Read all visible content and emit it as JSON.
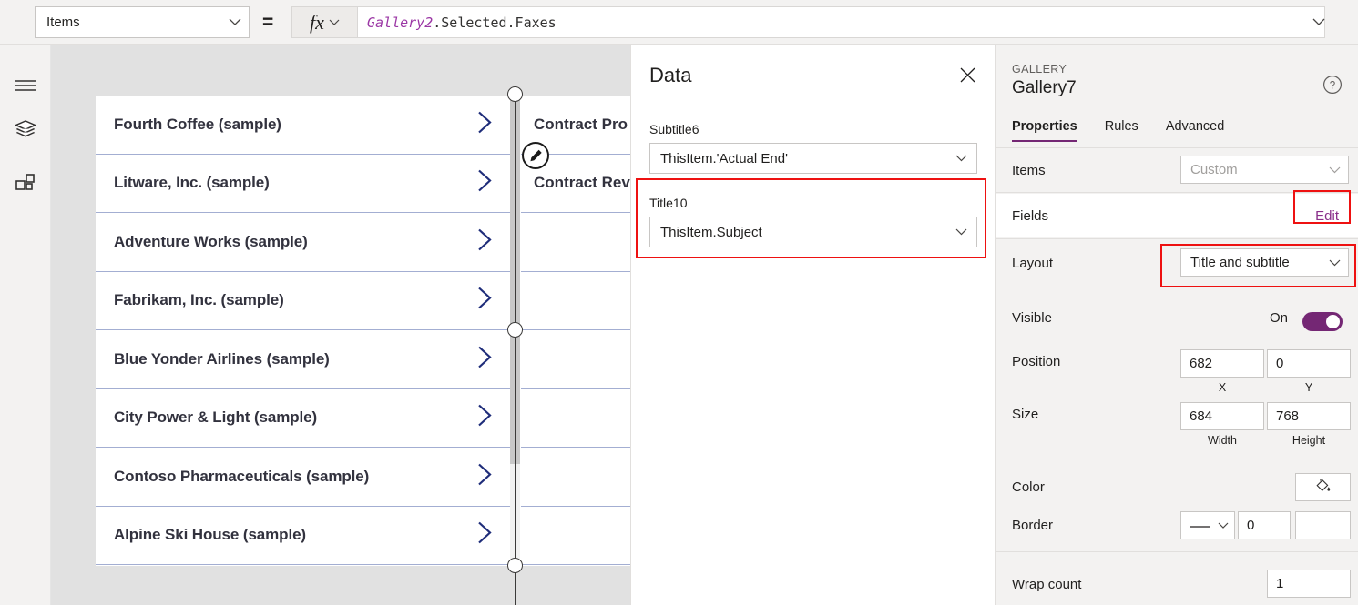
{
  "formula_bar": {
    "property_selected": "Items",
    "equals": "=",
    "fx_label": "fx",
    "formula_ident": "Gallery2",
    "formula_rest": ".Selected.Faxes"
  },
  "left_rail": {
    "items": [
      {
        "icon": "hamburger-menu-icon",
        "name": "menu"
      },
      {
        "icon": "layers-icon",
        "name": "tree-view"
      },
      {
        "icon": "components-grid-icon",
        "name": "insert"
      }
    ]
  },
  "canvas": {
    "gallery_companies": {
      "items": [
        {
          "title": "Fourth Coffee (sample)"
        },
        {
          "title": "Litware, Inc. (sample)"
        },
        {
          "title": "Adventure Works (sample)"
        },
        {
          "title": "Fabrikam, Inc. (sample)"
        },
        {
          "title": "Blue Yonder Airlines (sample)"
        },
        {
          "title": "City Power & Light (sample)"
        },
        {
          "title": "Contoso Pharmaceuticals (sample)"
        },
        {
          "title": "Alpine Ski House (sample)"
        }
      ]
    },
    "gallery_contracts": {
      "items": [
        {
          "title": "Contract Pro"
        },
        {
          "title": "Contract Rev"
        },
        {
          "title": ""
        },
        {
          "title": ""
        },
        {
          "title": ""
        },
        {
          "title": ""
        },
        {
          "title": ""
        },
        {
          "title": ""
        }
      ]
    },
    "chevron_color": "#1f2d7a",
    "row_divider_color": "#a3aed2"
  },
  "data_panel": {
    "title": "Data",
    "close_icon": "close-icon",
    "fields": [
      {
        "label": "Subtitle6",
        "value": "ThisItem.'Actual End'",
        "highlighted": false
      },
      {
        "label": "Title10",
        "value": "ThisItem.Subject",
        "highlighted": true
      }
    ]
  },
  "properties_panel": {
    "kicker": "GALLERY",
    "control_name": "Gallery7",
    "help_icon": "help-circle-icon",
    "tabs": [
      {
        "label": "Properties",
        "active": true
      },
      {
        "label": "Rules",
        "active": false
      },
      {
        "label": "Advanced",
        "active": false
      }
    ],
    "rows": {
      "items": {
        "label": "Items",
        "value": "Custom"
      },
      "fields": {
        "label": "Fields",
        "action": "Edit"
      },
      "layout": {
        "label": "Layout",
        "value": "Title and subtitle"
      },
      "visible": {
        "label": "Visible",
        "state": "On"
      },
      "position": {
        "label": "Position",
        "x": "682",
        "y": "0",
        "x_caption": "X",
        "y_caption": "Y"
      },
      "size": {
        "label": "Size",
        "width": "684",
        "height": "768",
        "width_caption": "Width",
        "height_caption": "Height"
      },
      "color": {
        "label": "Color",
        "icon": "paint-bucket-icon"
      },
      "border": {
        "label": "Border",
        "style": "———",
        "thickness": "0",
        "color_hex": "#0d2167"
      },
      "wrap_count": {
        "label": "Wrap count",
        "value": "1"
      }
    },
    "accent_color": "#742774"
  }
}
